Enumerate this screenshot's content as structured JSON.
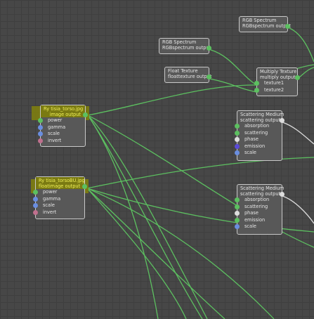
{
  "canvas": {
    "background": "#474747",
    "wire_color": "#5cc060"
  },
  "nodes": {
    "rgb1": {
      "title": "RGB Spectrum",
      "output": "RGBspectrum output"
    },
    "rgb2": {
      "title": "RGB Spectrum",
      "output": "RGBspectrum output"
    },
    "float_tex": {
      "title": "Float Texture",
      "output": "floattexture output"
    },
    "multiply": {
      "title": "Multiply Texture",
      "output": "multiply output",
      "inputs": [
        "texture1",
        "texture2"
      ]
    },
    "scatter1": {
      "title": "Scattering Medium",
      "output": "scattering output",
      "inputs": [
        "absorption",
        "scattering",
        "phase",
        "emission",
        "scale"
      ]
    },
    "scatter2": {
      "title": "Scattering Medium",
      "output": "scattering output",
      "inputs": [
        "absorption",
        "scattering",
        "phase",
        "emission",
        "scale"
      ]
    },
    "image1": {
      "title": "Ry tisia_torso.jpg",
      "output": "image output",
      "inputs": [
        "power",
        "gamma",
        "scale",
        "invert"
      ]
    },
    "image2": {
      "title": "Ry tisia_torsoBU.jpg",
      "output": "floatimage output",
      "inputs": [
        "power",
        "gamma",
        "scale",
        "invert"
      ]
    }
  }
}
